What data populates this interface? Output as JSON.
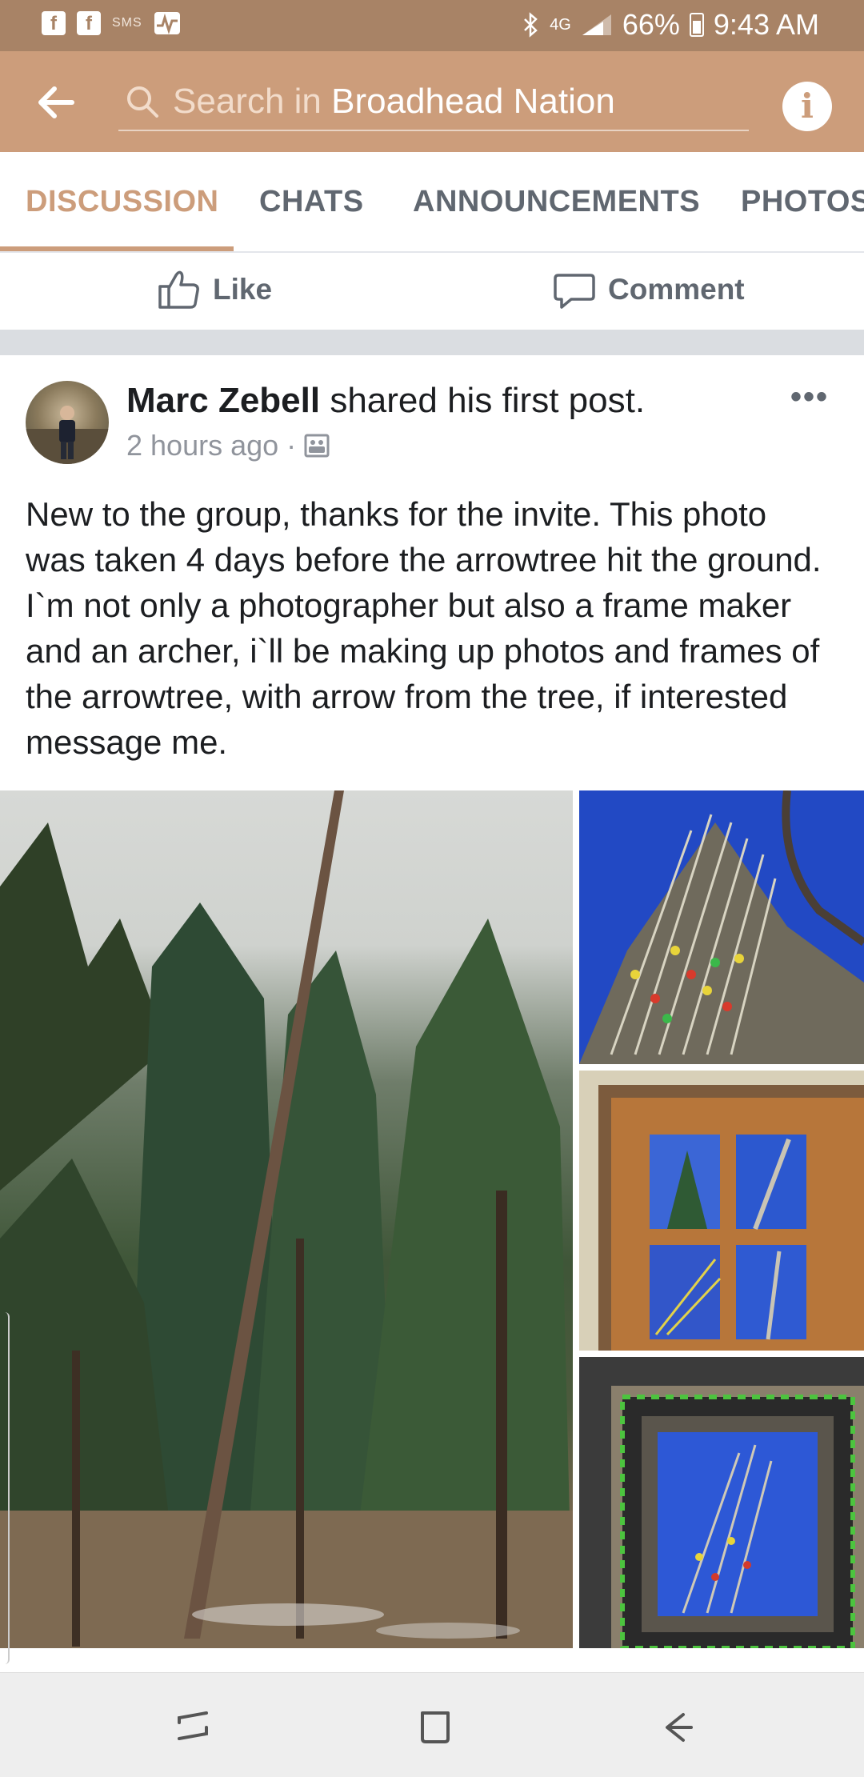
{
  "status_bar": {
    "sms_label": "SMS",
    "network": "4G",
    "battery": "66%",
    "time": "9:43 AM"
  },
  "app_bar": {
    "search_prefix": "Search in ",
    "group_name": "Broadhead Nation"
  },
  "tabs": [
    {
      "label": "DISCUSSION",
      "active": true
    },
    {
      "label": "CHATS",
      "active": false
    },
    {
      "label": "ANNOUNCEMENTS",
      "active": false
    },
    {
      "label": "PHOTOS",
      "active": false
    }
  ],
  "actions": {
    "like_label": "Like",
    "comment_label": "Comment"
  },
  "post": {
    "author": "Marc Zebell",
    "action_text": " shared his first post.",
    "time": "2 hours ago",
    "body": "New to the group, thanks for the invite. This photo was taken 4 days before the arrowtree hit the ground. I`m not only a photographer but also a frame maker and an archer, i`ll be making up photos and frames of the arrowtree, with arrow from the tree, if interested message me."
  },
  "colors": {
    "status_bar": "#a88366",
    "app_bar": "#cc9d7b",
    "active_tab": "#cc9d7b",
    "inactive_tab": "#606770"
  }
}
